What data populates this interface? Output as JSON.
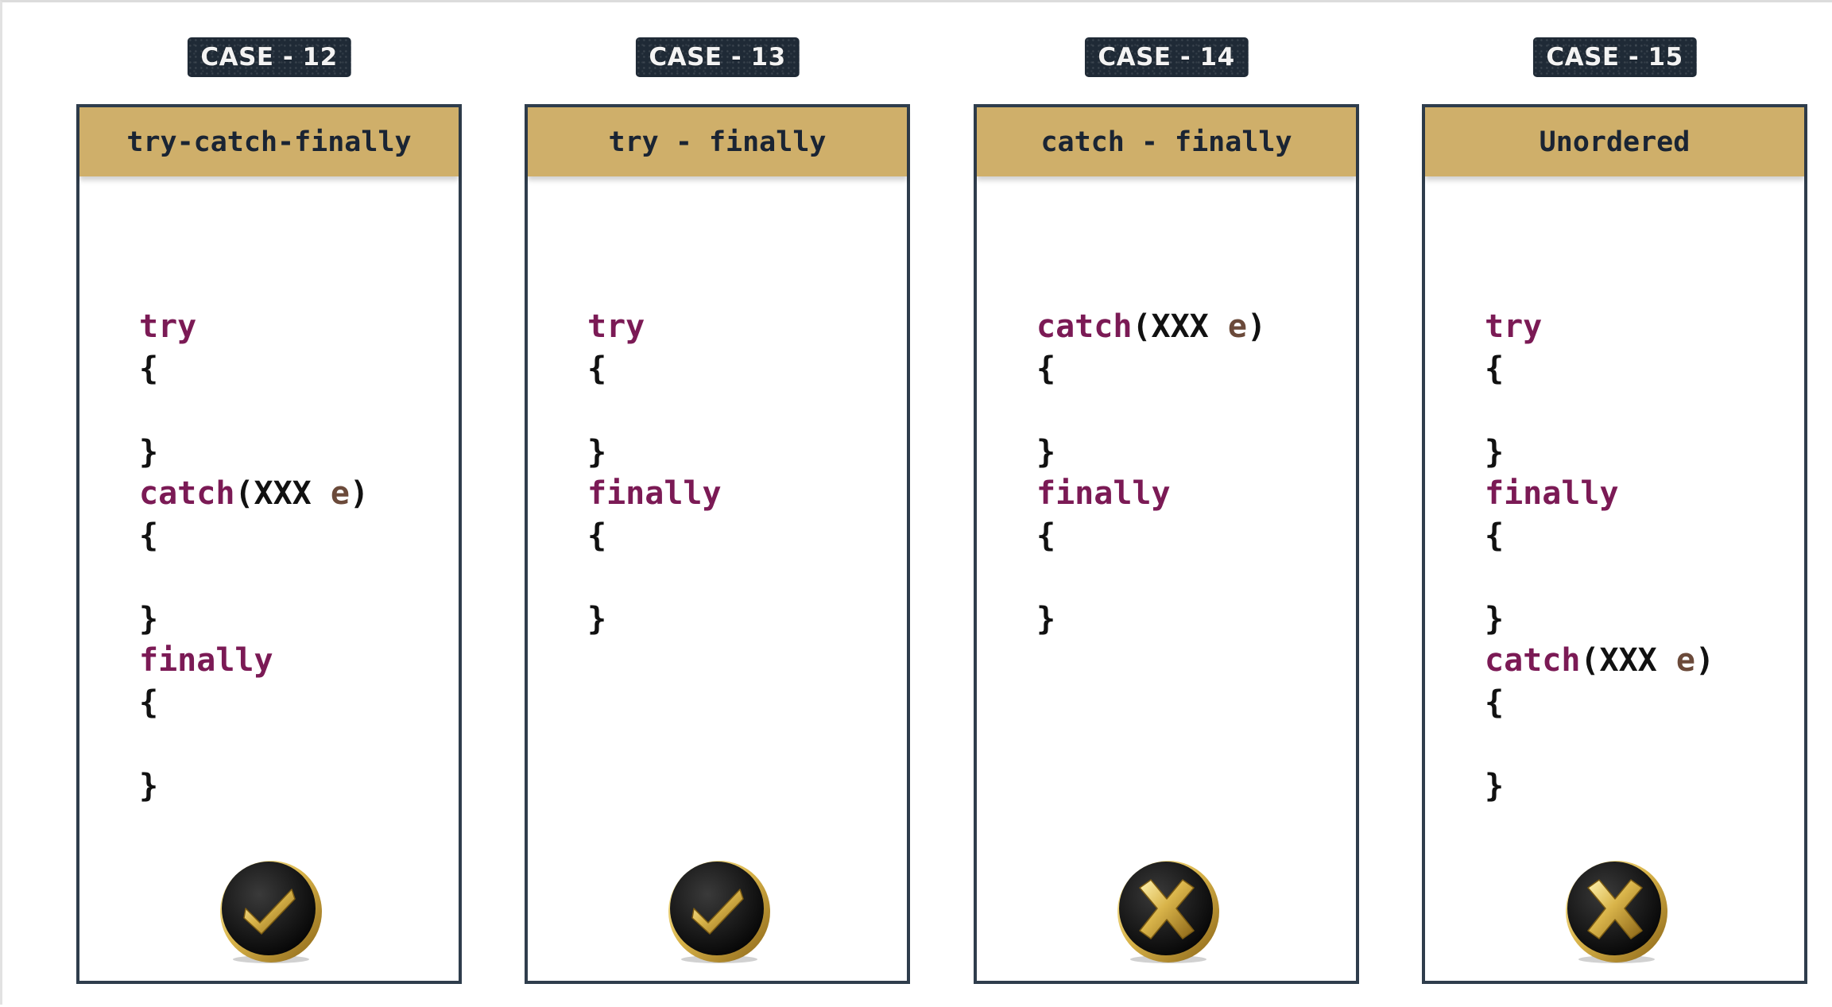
{
  "cases": [
    {
      "badge": "CASE - 12",
      "header": "try-catch-finally",
      "status": "valid",
      "status_icon": "gold-check-icon",
      "lines": [
        [
          {
            "t": "try",
            "k": "kw"
          }
        ],
        [
          {
            "t": "{",
            "k": "punct"
          }
        ],
        [],
        [
          {
            "t": "}",
            "k": "punct"
          }
        ],
        [
          {
            "t": "catch",
            "k": "kw"
          },
          {
            "t": "(",
            "k": "punct"
          },
          {
            "t": "XXX",
            "k": "cls"
          },
          {
            "t": " ",
            "k": "punct"
          },
          {
            "t": "e",
            "k": "var"
          },
          {
            "t": ")",
            "k": "punct"
          }
        ],
        [
          {
            "t": "{",
            "k": "punct"
          }
        ],
        [],
        [
          {
            "t": "}",
            "k": "punct"
          }
        ],
        [
          {
            "t": "finally",
            "k": "kw"
          }
        ],
        [
          {
            "t": "{",
            "k": "punct"
          }
        ],
        [],
        [
          {
            "t": "}",
            "k": "punct"
          }
        ]
      ]
    },
    {
      "badge": "CASE - 13",
      "header": "try - finally",
      "status": "valid",
      "status_icon": "gold-check-icon",
      "lines": [
        [
          {
            "t": "try",
            "k": "kw"
          }
        ],
        [
          {
            "t": "{",
            "k": "punct"
          }
        ],
        [],
        [
          {
            "t": "}",
            "k": "punct"
          }
        ],
        [
          {
            "t": "finally",
            "k": "kw"
          }
        ],
        [
          {
            "t": "{",
            "k": "punct"
          }
        ],
        [],
        [
          {
            "t": "}",
            "k": "punct"
          }
        ]
      ]
    },
    {
      "badge": "CASE - 14",
      "header": "catch - finally",
      "status": "invalid",
      "status_icon": "gold-cross-icon",
      "lines": [
        [
          {
            "t": "catch",
            "k": "kw"
          },
          {
            "t": "(",
            "k": "punct"
          },
          {
            "t": "XXX",
            "k": "cls"
          },
          {
            "t": " ",
            "k": "punct"
          },
          {
            "t": "e",
            "k": "var"
          },
          {
            "t": ")",
            "k": "punct"
          }
        ],
        [
          {
            "t": "{",
            "k": "punct"
          }
        ],
        [],
        [
          {
            "t": "}",
            "k": "punct"
          }
        ],
        [
          {
            "t": "finally",
            "k": "kw"
          }
        ],
        [
          {
            "t": "{",
            "k": "punct"
          }
        ],
        [],
        [
          {
            "t": "}",
            "k": "punct"
          }
        ]
      ]
    },
    {
      "badge": "CASE - 15",
      "header": "Unordered",
      "status": "invalid",
      "status_icon": "gold-cross-icon",
      "lines": [
        [
          {
            "t": "try",
            "k": "kw"
          }
        ],
        [
          {
            "t": "{",
            "k": "punct"
          }
        ],
        [],
        [
          {
            "t": "}",
            "k": "punct"
          }
        ],
        [
          {
            "t": "finally",
            "k": "kw"
          }
        ],
        [
          {
            "t": "{",
            "k": "punct"
          }
        ],
        [],
        [
          {
            "t": "}",
            "k": "punct"
          }
        ],
        [
          {
            "t": "catch",
            "k": "kw"
          },
          {
            "t": "(",
            "k": "punct"
          },
          {
            "t": "XXX",
            "k": "cls"
          },
          {
            "t": " ",
            "k": "punct"
          },
          {
            "t": "e",
            "k": "var"
          },
          {
            "t": ")",
            "k": "punct"
          }
        ],
        [
          {
            "t": "{",
            "k": "punct"
          }
        ],
        [],
        [
          {
            "t": "}",
            "k": "punct"
          }
        ]
      ]
    }
  ],
  "colors": {
    "badge_bg": "#1f2a36",
    "header_bg": "#cfaf6a",
    "panel_border": "#2f3d4c",
    "keyword": "#7b1a55",
    "variable": "#6b4a3a",
    "coin_gold": "#d9b44a"
  }
}
